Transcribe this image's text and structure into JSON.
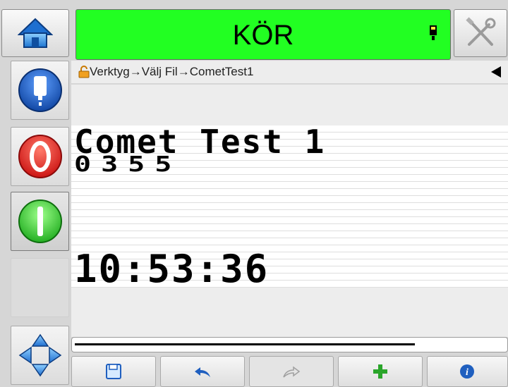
{
  "header": {
    "status_text": "KÖR",
    "status_color": "#22ff22",
    "home_icon": "home-icon",
    "tools_icon": "tools-icon",
    "ink_icon": "ink-indicator-icon"
  },
  "breadcrumb": {
    "lock_icon": "padlock-icon",
    "items": [
      "Verktyg",
      "Välj Fil",
      "CometTest1"
    ],
    "separator": "→",
    "back_icon": "back-triangle-icon"
  },
  "sidebar": {
    "buttons": [
      {
        "name": "ink-supply-button",
        "icon": "ink-bottle-icon"
      },
      {
        "name": "stop-button",
        "icon": "stop-icon"
      },
      {
        "name": "start-button",
        "icon": "start-icon"
      },
      {
        "name": "empty-button",
        "icon": ""
      },
      {
        "name": "navigate-button",
        "icon": "navigation-arrows-icon"
      }
    ]
  },
  "message": {
    "line1": "Comet Test 1",
    "line2": "0355",
    "line3": "10:53:36"
  },
  "footer": {
    "buttons": [
      {
        "name": "save-button",
        "icon": "floppy-disk-icon"
      },
      {
        "name": "undo-button",
        "icon": "undo-arrow-icon"
      },
      {
        "name": "redo-button",
        "icon": "redo-arrow-icon"
      },
      {
        "name": "add-button",
        "icon": "plus-icon"
      },
      {
        "name": "info-button",
        "icon": "info-icon"
      }
    ]
  },
  "colors": {
    "accent_green": "#22ff22",
    "stop_red": "#e62020",
    "start_green": "#2ecc2e",
    "ink_blue": "#1f5fbf"
  }
}
